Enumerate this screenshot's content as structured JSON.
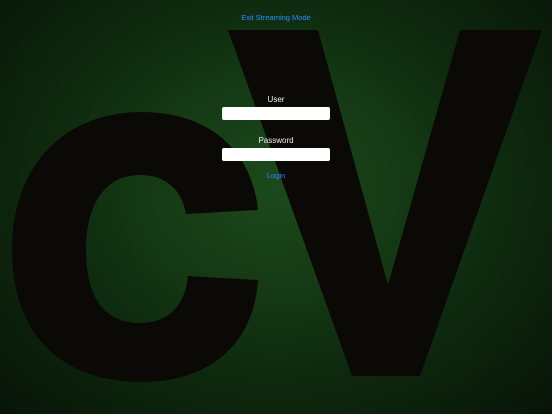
{
  "header": {
    "exit_label": "Exit Streaming Mode"
  },
  "logo": {
    "text": "cV",
    "color": "#0b0906"
  },
  "form": {
    "user_label": "User",
    "user_value": "",
    "password_label": "Password",
    "password_value": "",
    "login_label": "Login"
  },
  "colors": {
    "background_center": "#1c4a1c",
    "background_edge": "#081408",
    "link": "#2d8cff",
    "label_text": "#f0f0f0"
  }
}
